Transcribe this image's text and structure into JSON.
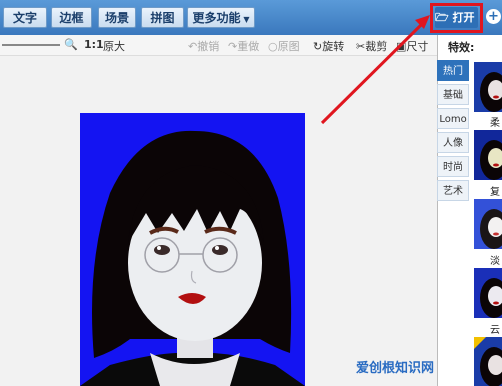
{
  "toolbar": {
    "tabs": [
      "文字",
      "边框",
      "场景",
      "拼图"
    ],
    "more": "更多功能",
    "open": "打开"
  },
  "edit": {
    "zoom_ratio": "1:1",
    "original": "原大",
    "undo": "撤销",
    "redo": "重做",
    "reset": "原图",
    "rotate": "旋转",
    "crop": "裁剪",
    "size": "尺寸"
  },
  "effects": {
    "title": "特效:",
    "tabs": [
      "热门",
      "基础",
      "Lomo",
      "人像",
      "时尚",
      "艺术"
    ],
    "active_tab": "热门",
    "thumbs": [
      "柔",
      "复",
      "淡",
      "云"
    ]
  },
  "watermark": "爱创根知识网",
  "colors": {
    "photo_bg": "#1414f2",
    "accent": "#e0161f"
  }
}
